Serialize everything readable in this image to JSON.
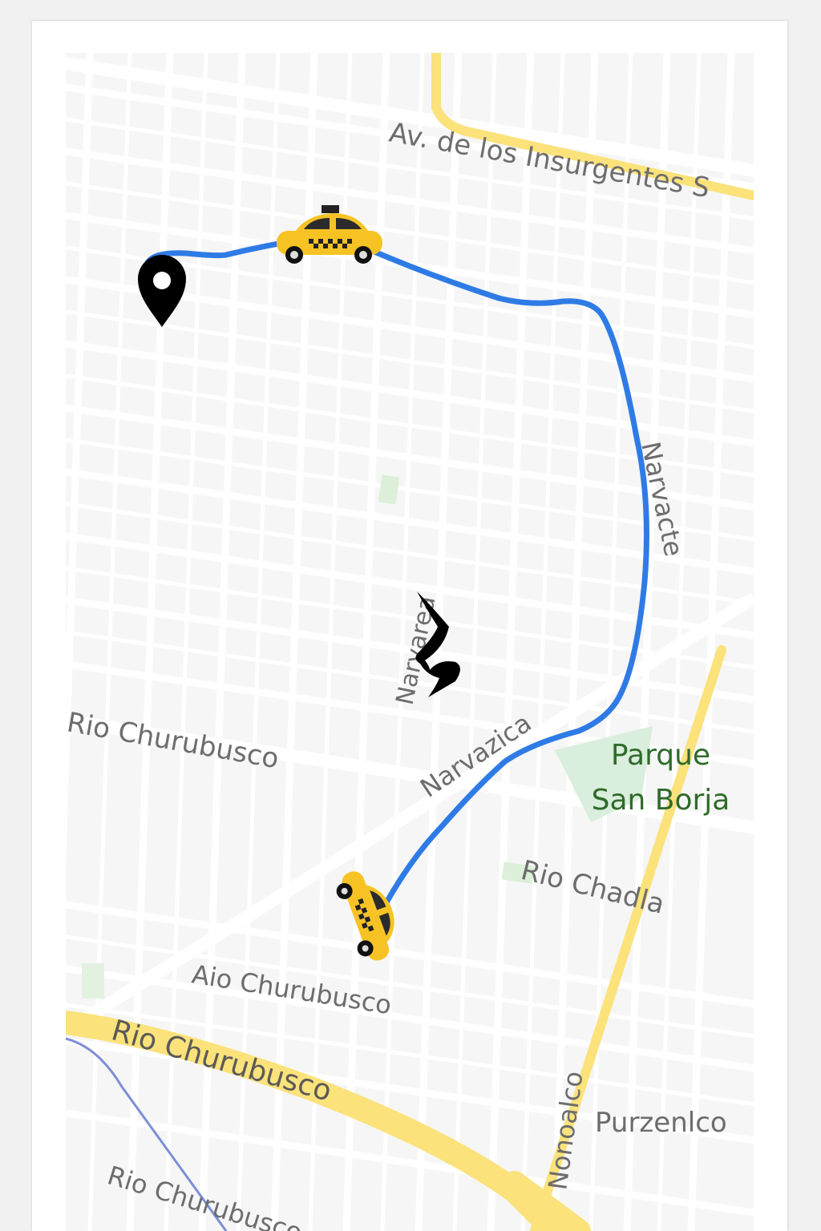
{
  "map": {
    "colors": {
      "background": "#f6f6f6",
      "street": "#ffffff",
      "block": "#ececec",
      "highway": "#fbe27a",
      "route": "#2f7be6",
      "park": "#d9eedc",
      "park_label": "#2f6b2a",
      "label": "#6d6d6d",
      "rail": "#7d8fd4"
    },
    "streets": {
      "insurgentes": "Av. de los Insurgentes S",
      "narvarte_top": "Narvar",
      "narvacte": "Narvacte",
      "narvarea": "Narvarea",
      "narvazica": "Narvazica",
      "churubusco_upper": "Rio Churubusco",
      "chadla": "Rio Chadla",
      "aio_churubusco": "Aio Churubusco",
      "churubusco_highway": "Rio Churubusco",
      "churubusco_lower": "Rio Churubusco",
      "nonoalco": "Nonoalco",
      "purzenlco": "Purzenlco"
    },
    "park": {
      "line1": "Parque",
      "line2": "San Borja"
    },
    "icons": {
      "destination": "location-pin-icon",
      "driver": "taxi-icon",
      "pickup": "taxi-icon",
      "user": "person-icon"
    }
  }
}
